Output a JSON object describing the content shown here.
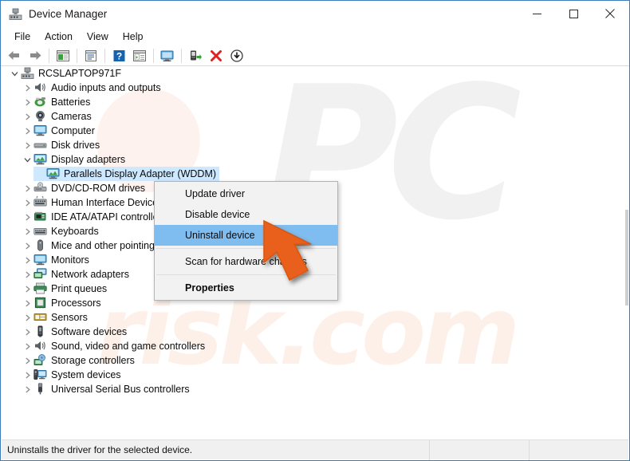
{
  "window": {
    "title": "Device Manager",
    "title_icon": "device-manager-icon",
    "controls": {
      "minimize": "minimize-button",
      "maximize": "maximize-button",
      "close": "close-button"
    }
  },
  "menubar": {
    "items": [
      {
        "label": "File"
      },
      {
        "label": "Action"
      },
      {
        "label": "View"
      },
      {
        "label": "Help"
      }
    ]
  },
  "toolbar": {
    "buttons": [
      {
        "name": "back-icon",
        "title": "Back"
      },
      {
        "name": "forward-icon",
        "title": "Forward"
      },
      {
        "name": "show-hide-console-tree-icon",
        "title": "Show/Hide console tree"
      },
      {
        "name": "properties-icon",
        "title": "Properties"
      },
      {
        "name": "help-icon",
        "title": "Help"
      },
      {
        "name": "refresh-icon",
        "title": "Refresh"
      },
      {
        "name": "scan-for-hardware-changes-icon",
        "title": "Scan for hardware changes"
      },
      {
        "name": "update-driver-icon",
        "title": "Update driver"
      },
      {
        "name": "uninstall-device-icon",
        "title": "Uninstall device"
      },
      {
        "name": "disable-device-icon",
        "title": "Disable device"
      }
    ]
  },
  "tree": {
    "root": {
      "label": "RCSLAPTOP971F",
      "icon": "computer-root-icon",
      "expanded": true
    },
    "items": [
      {
        "label": "Audio inputs and outputs",
        "icon": "speaker-icon",
        "expanded": false,
        "indent": 1,
        "selected": false
      },
      {
        "label": "Batteries",
        "icon": "battery-icon",
        "expanded": false,
        "indent": 1,
        "selected": false
      },
      {
        "label": "Cameras",
        "icon": "camera-icon",
        "expanded": false,
        "indent": 1,
        "selected": false
      },
      {
        "label": "Computer",
        "icon": "monitor-icon",
        "expanded": false,
        "indent": 1,
        "selected": false
      },
      {
        "label": "Disk drives",
        "icon": "disk-drive-icon",
        "expanded": false,
        "indent": 1,
        "selected": false
      },
      {
        "label": "Display adapters",
        "icon": "display-adapter-icon",
        "expanded": true,
        "indent": 1,
        "selected": false
      },
      {
        "label": "Parallels Display Adapter (WDDM)",
        "icon": "display-adapter-icon",
        "expanded": null,
        "indent": 2,
        "selected": true
      },
      {
        "label": "DVD/CD-ROM drives",
        "icon": "dvd-drive-icon",
        "expanded": false,
        "indent": 1,
        "selected": false
      },
      {
        "label": "Human Interface Devices",
        "icon": "hid-icon",
        "expanded": false,
        "indent": 1,
        "selected": false
      },
      {
        "label": "IDE ATA/ATAPI controllers",
        "icon": "ide-controller-icon",
        "expanded": false,
        "indent": 1,
        "selected": false
      },
      {
        "label": "Keyboards",
        "icon": "keyboard-icon",
        "expanded": false,
        "indent": 1,
        "selected": false
      },
      {
        "label": "Mice and other pointing devices",
        "icon": "mouse-icon",
        "expanded": false,
        "indent": 1,
        "selected": false
      },
      {
        "label": "Monitors",
        "icon": "monitor-icon",
        "expanded": false,
        "indent": 1,
        "selected": false
      },
      {
        "label": "Network adapters",
        "icon": "network-adapter-icon",
        "expanded": false,
        "indent": 1,
        "selected": false
      },
      {
        "label": "Print queues",
        "icon": "printer-icon",
        "expanded": false,
        "indent": 1,
        "selected": false
      },
      {
        "label": "Processors",
        "icon": "processor-icon",
        "expanded": false,
        "indent": 1,
        "selected": false
      },
      {
        "label": "Sensors",
        "icon": "sensor-icon",
        "expanded": false,
        "indent": 1,
        "selected": false
      },
      {
        "label": "Software devices",
        "icon": "software-device-icon",
        "expanded": false,
        "indent": 1,
        "selected": false
      },
      {
        "label": "Sound, video and game controllers",
        "icon": "speaker-icon",
        "expanded": false,
        "indent": 1,
        "selected": false
      },
      {
        "label": "Storage controllers",
        "icon": "storage-controller-icon",
        "expanded": false,
        "indent": 1,
        "selected": false
      },
      {
        "label": "System devices",
        "icon": "system-device-icon",
        "expanded": false,
        "indent": 1,
        "selected": false
      },
      {
        "label": "Universal Serial Bus controllers",
        "icon": "usb-icon",
        "expanded": false,
        "indent": 1,
        "selected": false
      }
    ]
  },
  "context_menu": {
    "items": [
      {
        "label": "Update driver",
        "highlighted": false,
        "bold": false
      },
      {
        "label": "Disable device",
        "highlighted": false,
        "bold": false
      },
      {
        "label": "Uninstall device",
        "highlighted": true,
        "bold": false
      },
      {
        "separator": true
      },
      {
        "label": "Scan for hardware changes",
        "highlighted": false,
        "bold": false
      },
      {
        "separator": true
      },
      {
        "label": "Properties",
        "highlighted": false,
        "bold": true
      }
    ]
  },
  "statusbar": {
    "text": "Uninstalls the driver for the selected device."
  },
  "watermark": {
    "primary": "PC",
    "secondary": "risk.com"
  },
  "colors": {
    "selection_blue": "#cde8ff",
    "menu_highlight": "#7fbdf0",
    "cursor_orange": "#e8601c",
    "window_border": "#3a7ebc",
    "statusbar_bg": "#f0f0f0"
  }
}
